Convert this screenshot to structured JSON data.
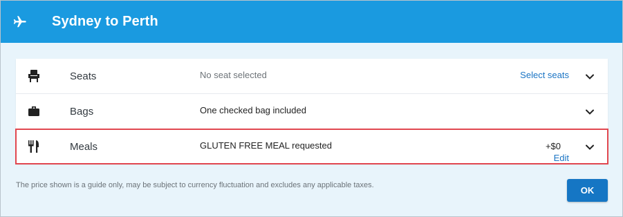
{
  "header": {
    "title": "Sydney to Perth",
    "icon": "airplane-icon",
    "background": "#1a9ae0"
  },
  "rows": [
    {
      "icon": "seat-icon",
      "label": "Seats",
      "status": "No seat selected",
      "action": "Select seats"
    },
    {
      "icon": "briefcase-icon",
      "label": "Bags",
      "status": "One checked bag included"
    },
    {
      "icon": "utensils-icon",
      "label": "Meals",
      "status": "GLUTEN FREE MEAL requested",
      "price": "+$0",
      "action": "Edit",
      "highlighted": true
    }
  ],
  "footer": {
    "disclaimer": "The price shown is a guide only, may be subject to currency fluctuation and excludes any applicable taxes.",
    "ok_label": "OK"
  },
  "colors": {
    "link": "#1a74c4",
    "button": "#1576c4",
    "highlight_border": "#e1474f",
    "background": "#e8f4fb"
  }
}
